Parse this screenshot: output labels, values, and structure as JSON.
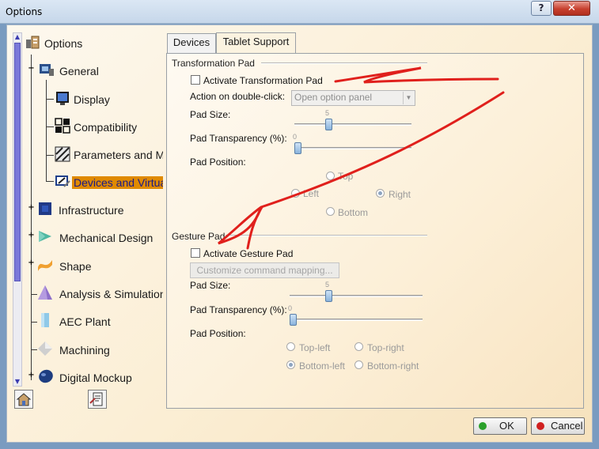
{
  "window": {
    "title": "Options",
    "help_glyph": "?",
    "close_glyph": "✕"
  },
  "tree": {
    "root": {
      "label": "Options",
      "icon": "options-icon"
    },
    "items": [
      {
        "label": "General",
        "icon": "general-icon",
        "expander": "−"
      },
      {
        "label": "Display",
        "icon": "display-icon"
      },
      {
        "label": "Compatibility",
        "icon": "compatibility-icon"
      },
      {
        "label": "Parameters and M",
        "icon": "parameters-icon"
      },
      {
        "label": "Devices and Virtua",
        "icon": "devices-icon",
        "selected": true
      },
      {
        "label": "Infrastructure",
        "icon": "infrastructure-icon",
        "expander": "+"
      },
      {
        "label": "Mechanical Design",
        "icon": "mechanical-design-icon",
        "expander": "+"
      },
      {
        "label": "Shape",
        "icon": "shape-icon",
        "expander": "+"
      },
      {
        "label": "Analysis & Simulation",
        "icon": "analysis-icon"
      },
      {
        "label": "AEC Plant",
        "icon": "aec-plant-icon"
      },
      {
        "label": "Machining",
        "icon": "machining-icon"
      },
      {
        "label": "Digital Mockup",
        "icon": "digital-mockup-icon",
        "expander": "+"
      }
    ]
  },
  "tabs": [
    {
      "label": "Devices",
      "active": false
    },
    {
      "label": "Tablet Support",
      "active": true
    }
  ],
  "transformation_pad": {
    "group_title": "Transformation Pad",
    "activate_label": "Activate Transformation Pad",
    "activate_checked": false,
    "double_click_label": "Action on double-click:",
    "double_click_value": "Open option panel",
    "pad_size_label": "Pad Size:",
    "pad_size_value": "5",
    "pad_size_fraction": 0.28,
    "transparency_label": "Pad Transparency (%):",
    "transparency_value": "0",
    "transparency_fraction": 0.0,
    "position_label": "Pad Position:",
    "positions": [
      {
        "label": "Top",
        "checked": false
      },
      {
        "label": "Left",
        "checked": false
      },
      {
        "label": "Right",
        "checked": true
      },
      {
        "label": "Bottom",
        "checked": false
      }
    ]
  },
  "gesture_pad": {
    "group_title": "Gesture Pad",
    "activate_label": "Activate Gesture Pad",
    "activate_checked": false,
    "customize_label": "Customize command mapping...",
    "pad_size_label": "Pad Size:",
    "pad_size_value": "5",
    "pad_size_fraction": 0.28,
    "transparency_label": "Pad Transparency (%):",
    "transparency_value": "0",
    "transparency_fraction": 0.0,
    "position_label": "Pad Position:",
    "positions": [
      {
        "label": "Top-left",
        "checked": false
      },
      {
        "label": "Top-right",
        "checked": false
      },
      {
        "label": "Bottom-left",
        "checked": true
      },
      {
        "label": "Bottom-right",
        "checked": false
      }
    ]
  },
  "footer": {
    "ok_label": "OK",
    "cancel_label": "Cancel"
  },
  "colors": {
    "selection": "#e08a00",
    "annotation": "#e0201c",
    "ok_dot": "#2aa02a",
    "cancel_dot": "#d02020"
  }
}
